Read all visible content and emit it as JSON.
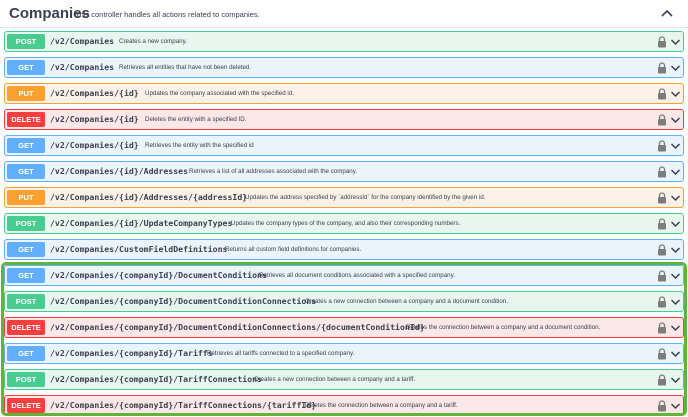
{
  "header": {
    "title": "Companies",
    "description": "This controller handles all actions related to companies."
  },
  "operations": [
    {
      "method": "POST",
      "path": "/v2/Companies",
      "summary": "Creates a new company."
    },
    {
      "method": "GET",
      "path": "/v2/Companies",
      "summary": "Retrieves all entities that have not been deleted."
    },
    {
      "method": "PUT",
      "path": "/v2/Companies/{id}",
      "summary": "Updates the company associated with the specified id."
    },
    {
      "method": "DELETE",
      "path": "/v2/Companies/{id}",
      "summary": "Deletes the entity with a specified ID."
    },
    {
      "method": "GET",
      "path": "/v2/Companies/{id}",
      "summary": "Retrieves the entity with the specified id"
    },
    {
      "method": "GET",
      "path": "/v2/Companies/{id}/Addresses",
      "summary": "Retrieves a list of all addresses associated with the company."
    },
    {
      "method": "PUT",
      "path": "/v2/Companies/{id}/Addresses/{addressId}",
      "summary": "Updates the address specified by `addressId` for the company identified by the given id."
    },
    {
      "method": "POST",
      "path": "/v2/Companies/{id}/UpdateCompanyTypes",
      "summary": "Updates the company types of the company, and also their corresponding numbers."
    },
    {
      "method": "GET",
      "path": "/v2/Companies/CustomFieldDefinitions",
      "summary": "Returns all custom field definitions for companies."
    },
    {
      "method": "GET",
      "path": "/v2/Companies/{companyId}/DocumentConditions",
      "summary": "Retrieves all document conditions associated with a specified company."
    },
    {
      "method": "POST",
      "path": "/v2/Companies/{companyId}/DocumentConditionConnections",
      "summary": "Creates a new connection between a company and a document condition."
    },
    {
      "method": "DELETE",
      "path": "/v2/Companies/{companyId}/DocumentConditionConnections/{documentConditionId}",
      "summary": "Deletes the connection between a company and a document condition."
    },
    {
      "method": "GET",
      "path": "/v2/Companies/{companyId}/Tariffs",
      "summary": "Retrieves all tariffs connected to a specified company."
    },
    {
      "method": "POST",
      "path": "/v2/Companies/{companyId}/TariffConnections",
      "summary": "Creates a new connection between a company and a tariff."
    },
    {
      "method": "DELETE",
      "path": "/v2/Companies/{companyId}/TariffConnections/{tariffId}",
      "summary": "Deletes the connection between a company and a tariff."
    }
  ],
  "icons": {
    "collapse": "chevron-up-icon",
    "lock": "lock-icon",
    "expand": "chevron-down-icon"
  },
  "colors": {
    "post": "#49cc90",
    "get": "#61affe",
    "put": "#fca130",
    "delete": "#f93e3e",
    "highlight": "#5fb43a"
  }
}
